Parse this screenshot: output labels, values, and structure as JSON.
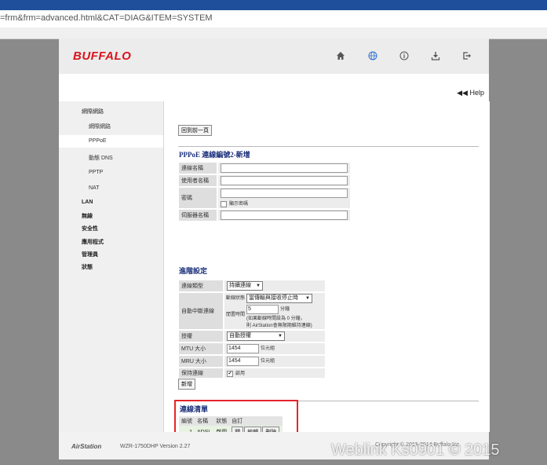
{
  "browser": {
    "url": "=frm&frm=advanced.html&CAT=DIAG&ITEM=SYSTEM"
  },
  "header": {
    "logo": "BUFFALO",
    "icons": [
      "home-icon",
      "globe-icon",
      "info-icon",
      "download-icon",
      "logout-icon"
    ]
  },
  "help": {
    "label": "Help",
    "arrows": "◀◀"
  },
  "sidebar": {
    "items": [
      {
        "label": "網際網路",
        "level": 0
      },
      {
        "label": "網際網路",
        "level": 1
      },
      {
        "label": "PPPoE",
        "level": 1,
        "active": true
      },
      {
        "label": "動態 DNS",
        "level": 1
      },
      {
        "label": "PPTP",
        "level": 1
      },
      {
        "label": "NAT",
        "level": 1
      },
      {
        "label": "LAN",
        "level": 0
      },
      {
        "label": "無線",
        "level": 0
      },
      {
        "label": "安全性",
        "level": 0
      },
      {
        "label": "應用程式",
        "level": 0
      },
      {
        "label": "管理員",
        "level": 0
      },
      {
        "label": "狀態",
        "level": 0
      }
    ]
  },
  "main": {
    "back_button": "回到前一頁",
    "section_title": "PPPoE 連線編號2-新增",
    "fields": {
      "connection_name": {
        "label": "連線名稱",
        "value": ""
      },
      "username": {
        "label": "使用者名稱",
        "value": ""
      },
      "password": {
        "label": "密碼",
        "value": "",
        "show_label": "顯示密碼"
      },
      "server_name": {
        "label": "伺服器名稱",
        "value": ""
      }
    },
    "advanced": {
      "title": "進階設定",
      "connection_type": {
        "label": "連線類型",
        "value": "持續連線"
      },
      "auto_disconnect": {
        "label": "自動中斷連線",
        "timing_label": "斷線狀態",
        "timing_value": "當傳輸與接收停止時",
        "idle_label": "閒置時間",
        "idle_value": "5",
        "idle_unit": "分鐘",
        "note_line1": "(如果斷線時間設為 0 分鐘，",
        "note_line2": "則 AirStation會無限期維持連線)"
      },
      "auth": {
        "label": "授權",
        "value": "自動授權"
      },
      "mtu": {
        "label": "MTU 大小",
        "value": "1454",
        "unit": "位元組"
      },
      "mru": {
        "label": "MRU 大小",
        "value": "1454",
        "unit": "位元組"
      },
      "keepalive": {
        "label": "保持連線",
        "option": "啟用",
        "checked": true
      },
      "add_button": "新增"
    },
    "connection_list": {
      "title": "連線清單",
      "headers": [
        "編號",
        "名稱",
        "狀態",
        "自訂"
      ],
      "rows": [
        {
          "num": "1",
          "name": "ADSL",
          "status": "啟用",
          "buttons": [
            "關",
            "編輯",
            "刪除"
          ]
        }
      ]
    }
  },
  "footer": {
    "brand": "AirStation",
    "model": "WZR-1750DHP",
    "version": "Version 2.27",
    "copyright": "Copyright © 2013-2014 Buffalo Inc."
  },
  "watermark": "Weblink Ks0901 © 2015",
  "colors": {
    "logo": "#d9131c",
    "highlight_box": "#e5242b",
    "title": "#1a2f7a",
    "list_row": "#e8f3e3"
  }
}
